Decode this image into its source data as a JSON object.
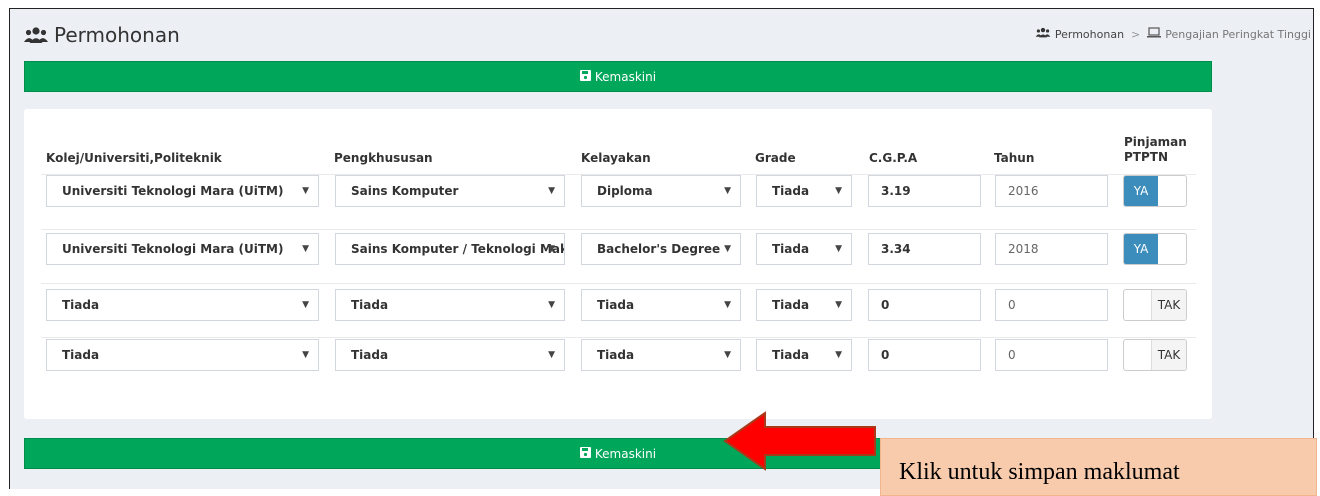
{
  "page": {
    "title": "Permohonan",
    "breadcrumb": [
      "Permohonan",
      "Pengajian Peringkat Tinggi"
    ]
  },
  "buttons": {
    "update_label": "Kemaskini"
  },
  "table": {
    "headers": {
      "institution": "Kolej/Universiti,Politeknik",
      "specialization": "Pengkhususan",
      "qualification": "Kelayakan",
      "grade": "Grade",
      "cgpa": "C.G.P.A",
      "year": "Tahun",
      "ptptn_line1": "Pinjaman",
      "ptptn_line2": "PTPTN"
    },
    "rows": [
      {
        "institution": "Universiti Teknologi Mara (UiTM)",
        "specialization": "Sains Komputer",
        "qualification": "Diploma",
        "grade": "Tiada",
        "cgpa": "3.19",
        "year": "2016",
        "ptptn": "YA"
      },
      {
        "institution": "Universiti Teknologi Mara (UiTM)",
        "specialization": "Sains Komputer / Teknologi Maklumat",
        "qualification": "Bachelor's Degree",
        "grade": "Tiada",
        "cgpa": "3.34",
        "year": "2018",
        "ptptn": "YA"
      },
      {
        "institution": "Tiada",
        "specialization": "Tiada",
        "qualification": "Tiada",
        "grade": "Tiada",
        "cgpa": "0",
        "year": "0",
        "ptptn": "TAK"
      },
      {
        "institution": "Tiada",
        "specialization": "Tiada",
        "qualification": "Tiada",
        "grade": "Tiada",
        "cgpa": "0",
        "year": "0",
        "ptptn": "TAK"
      }
    ]
  },
  "annotation": {
    "callout": "Klik untuk simpan maklumat"
  },
  "colors": {
    "accent_green": "#00a65a",
    "toggle_blue": "#3c8dbc",
    "arrow_red": "#ff0000",
    "callout_bg": "#f8cbad"
  },
  "icons": [
    "users-icon",
    "save-icon",
    "laptop-icon",
    "dropdown-caret-icon",
    "red-arrow-icon"
  ]
}
